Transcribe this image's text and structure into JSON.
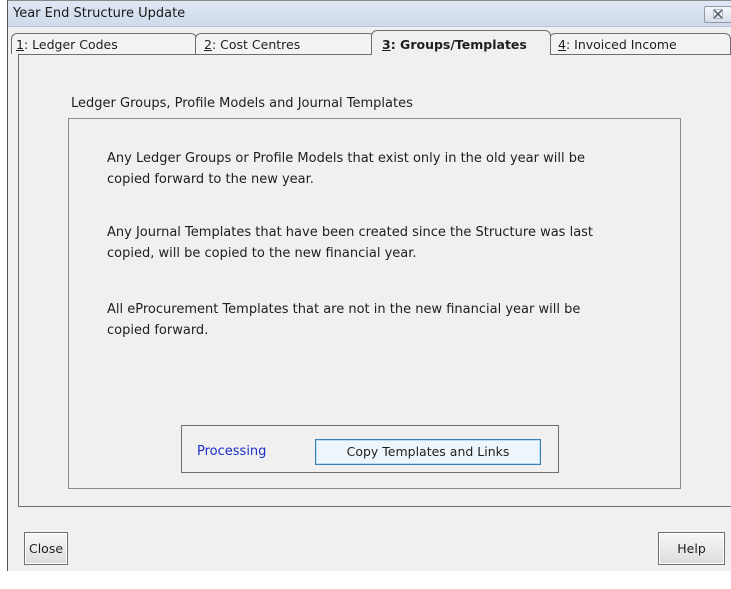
{
  "window": {
    "title": "Year End Structure Update"
  },
  "tabs": [
    {
      "mnemonic": "1",
      "label": ": Ledger Codes",
      "active": false
    },
    {
      "mnemonic": "2",
      "label": ": Cost Centres",
      "active": false
    },
    {
      "mnemonic": "3",
      "label": ": Groups/Templates",
      "active": true
    },
    {
      "mnemonic": "4",
      "label": ": Invoiced Income",
      "active": false
    }
  ],
  "panel": {
    "heading": "Ledger Groups, Profile Models and Journal Templates",
    "paragraphs": [
      "Any Ledger Groups or Profile Models that exist only in the old year will be copied forward to the new year.",
      "Any Journal Templates that have been created since the Structure was last copied, will be copied to the new financial year.",
      "All eProcurement Templates that are not in the new financial year will be copied forward."
    ],
    "processing_label": "Processing",
    "action_button": "Copy Templates and Links"
  },
  "footer": {
    "close_label": "Close",
    "help_label": "Help"
  },
  "colors": {
    "processing_text": "#1c2fc9",
    "focused_button_border": "#3c7fb1"
  }
}
